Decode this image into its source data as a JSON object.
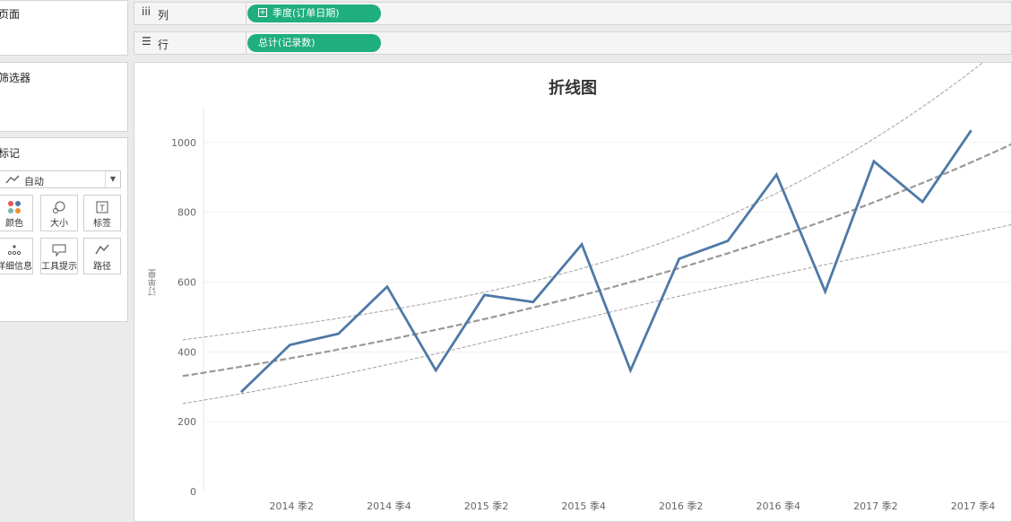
{
  "left_panel": {
    "pages_title": "页面",
    "filters_title": "筛选器",
    "marks": {
      "title": "标记",
      "mark_type": "自动",
      "buttons": [
        {
          "label": "颜色",
          "icon": "color-dots-icon"
        },
        {
          "label": "大小",
          "icon": "size-icon"
        },
        {
          "label": "标签",
          "icon": "label-icon"
        },
        {
          "label": "详细信息",
          "icon": "detail-icon"
        },
        {
          "label": "工具提示",
          "icon": "tooltip-icon"
        },
        {
          "label": "路径",
          "icon": "path-icon"
        }
      ]
    }
  },
  "shelves": {
    "columns": {
      "icon": "iii",
      "label": "列",
      "pill": "季度(订单日期)"
    },
    "rows": {
      "icon": "☰",
      "label": "行",
      "pill": "总计(记录数)"
    }
  },
  "colors": {
    "pill": "#1fae7e",
    "line": "#4e79a7",
    "trend": "#999999"
  },
  "chart_data": {
    "type": "line",
    "title": "折线图",
    "ylabel": "订单量",
    "xlabel": "",
    "ylim": [
      0,
      1100
    ],
    "yticks": [
      0,
      200,
      400,
      600,
      800,
      1000
    ],
    "x": [
      "2014 季1",
      "2014 季2",
      "2014 季3",
      "2014 季4",
      "2015 季1",
      "2015 季2",
      "2015 季3",
      "2015 季4",
      "2016 季1",
      "2016 季2",
      "2016 季3",
      "2016 季4",
      "2017 季1",
      "2017 季2",
      "2017 季3",
      "2017 季4"
    ],
    "x_tick_labels": [
      "2014 季2",
      "2014 季4",
      "2015 季2",
      "2015 季4",
      "2016 季2",
      "2016 季4",
      "2017 季2",
      "2017 季4"
    ],
    "series": [
      {
        "values": [
          285,
          420,
          452,
          587,
          347,
          563,
          543,
          708,
          347,
          667,
          718,
          908,
          573,
          946,
          830,
          1035
        ]
      }
    ],
    "trend_line": {
      "type": "exponential",
      "show_confidence_bands": true
    },
    "grid": true
  }
}
